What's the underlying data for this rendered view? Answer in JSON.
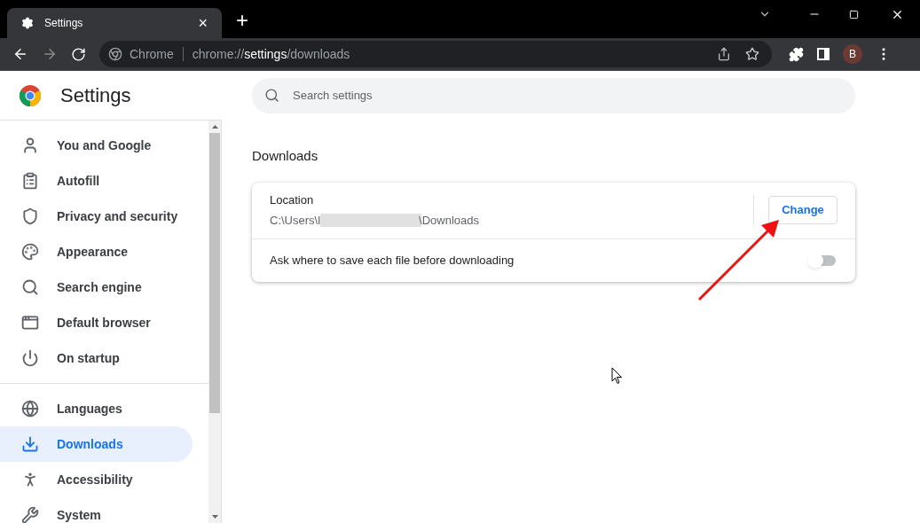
{
  "tab": {
    "title": "Settings",
    "close": "×"
  },
  "new_tab": "+",
  "address": {
    "site": "Chrome",
    "url_prefix": "chrome://",
    "url_host": "settings",
    "url_path": "/downloads"
  },
  "profile": "B",
  "header": {
    "title": "Settings",
    "search_placeholder": "Search settings"
  },
  "sidebar": {
    "groups": [
      {
        "items": [
          {
            "label": "You and Google",
            "selected": false
          },
          {
            "label": "Autofill",
            "selected": false
          },
          {
            "label": "Privacy and security",
            "selected": false
          },
          {
            "label": "Appearance",
            "selected": false
          },
          {
            "label": "Search engine",
            "selected": false
          },
          {
            "label": "Default browser",
            "selected": false
          },
          {
            "label": "On startup",
            "selected": false
          }
        ]
      },
      {
        "items": [
          {
            "label": "Languages",
            "selected": false
          },
          {
            "label": "Downloads",
            "selected": true
          },
          {
            "label": "Accessibility",
            "selected": false
          },
          {
            "label": "System",
            "selected": false
          }
        ]
      }
    ]
  },
  "section": {
    "title": "Downloads",
    "location": {
      "label": "Location",
      "path_start": "C:\\Users\\l",
      "path_end": "\\Downloads",
      "button": "Change"
    },
    "ask_toggle": {
      "label": "Ask where to save each file before downloading",
      "on": false
    }
  }
}
